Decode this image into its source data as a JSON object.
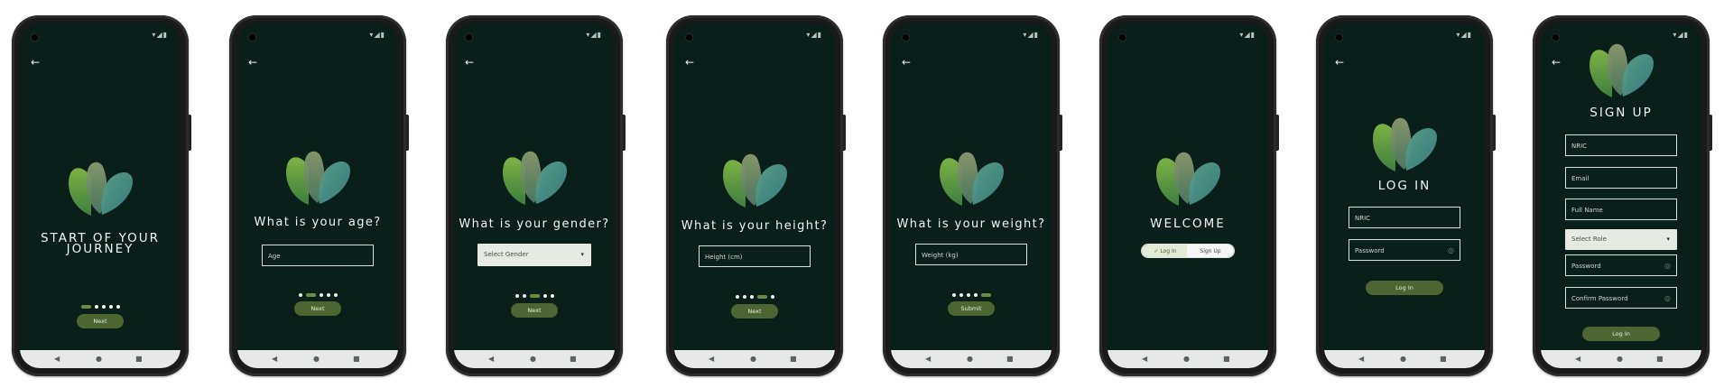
{
  "screens": {
    "s1": {
      "title_line1": "START OF YOUR",
      "title_line2": "JOURNEY",
      "button": "Next"
    },
    "s2": {
      "title": "What is your age?",
      "placeholder": "Age",
      "button": "Next"
    },
    "s3": {
      "title": "What is your gender?",
      "select_value": "Select Gender",
      "button": "Next"
    },
    "s4": {
      "title": "What is your height?",
      "placeholder": "Height (cm)",
      "button": "Next"
    },
    "s5": {
      "title": "What is your weight?",
      "placeholder": "Weight (kg)",
      "button": "Submit"
    },
    "s6": {
      "title": "WELCOME",
      "login_tab": "Log In",
      "signup_tab": "Sign Up"
    },
    "s7": {
      "title": "LOG IN",
      "nric": "NRIC",
      "password": "Password",
      "button": "Log In"
    },
    "s8": {
      "title": "SIGN UP",
      "nric": "NRIC",
      "email": "Email",
      "full_name": "Full Name",
      "role": "Select Role",
      "password": "Password",
      "confirm_password": "Confirm Password",
      "button": "Log In"
    }
  },
  "icons": {
    "back": "back-arrow-icon",
    "logo": "heart-leaf-logo-icon",
    "nav_back": "triangle-back-icon",
    "nav_home": "circle-home-icon",
    "nav_recent": "square-recents-icon",
    "eye": "eye-off-icon",
    "check": "check-icon",
    "caret": "dropdown-caret-icon"
  },
  "colors": {
    "background": "#0a1f19",
    "accent": "#4d6530",
    "dot_active": "#6f8a45",
    "logo_green": "#6aa63a",
    "logo_teal": "#3f8f88"
  }
}
